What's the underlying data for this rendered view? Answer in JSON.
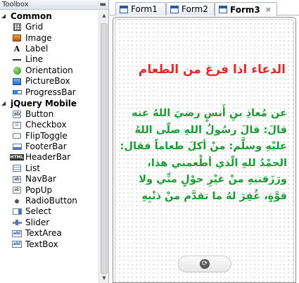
{
  "toolbox": {
    "title": "Toolbox",
    "groups": [
      {
        "label": "Common",
        "items": [
          {
            "label": "Grid",
            "icon": "grid-icon"
          },
          {
            "label": "Image",
            "icon": "image-icon"
          },
          {
            "label": "Label",
            "icon": "label-icon"
          },
          {
            "label": "Line",
            "icon": "line-icon"
          },
          {
            "label": "Orientation",
            "icon": "orientation-icon"
          },
          {
            "label": "PictureBox",
            "icon": "picturebox-icon"
          },
          {
            "label": "ProgressBar",
            "icon": "progressbar-icon"
          }
        ]
      },
      {
        "label": "jQuery Mobile",
        "items": [
          {
            "label": "Button",
            "icon": "button-icon",
            "icon_text": "ab"
          },
          {
            "label": "Checkbox",
            "icon": "checkbox-icon"
          },
          {
            "label": "FlipToggle",
            "icon": "fliptoggle-icon"
          },
          {
            "label": "FooterBar",
            "icon": "footerbar-icon"
          },
          {
            "label": "HeaderBar",
            "icon": "headerbar-icon",
            "icon_text": "HTML"
          },
          {
            "label": "List",
            "icon": "list-icon"
          },
          {
            "label": "NavBar",
            "icon": "navbar-icon",
            "icon_text": "ab"
          },
          {
            "label": "PopUp",
            "icon": "popup-icon",
            "icon_text": "ab"
          },
          {
            "label": "RadioButton",
            "icon": "radiobutton-icon"
          },
          {
            "label": "Select",
            "icon": "select-icon"
          },
          {
            "label": "Slider",
            "icon": "slider-icon"
          },
          {
            "label": "TextArea",
            "icon": "textarea-icon",
            "icon_text": "abl"
          },
          {
            "label": "TextBox",
            "icon": "textbox-icon",
            "icon_text": "abl"
          }
        ]
      }
    ]
  },
  "tabs": [
    {
      "label": "Form1",
      "active": false
    },
    {
      "label": "Form2",
      "active": false
    },
    {
      "label": "Form3",
      "active": true,
      "close": "×"
    }
  ],
  "form": {
    "title": "الدعاء اذا فرغ من الطعام",
    "body": "عن مُعاذِ بنِ أَنسٍ رضيَ اللهُ عنه قالَ: قالَ رسُولُ اللهِ صلّى اللهُ عليْهِ وسلَّم: منْ أكلَ طعاماً فقال: الحمْدُ للهِ الّذي أطْعمني هذا، ورَزَقنيهِ منْ غيْرِ حوْلٍ منِّي ولا قوَّةٍ، غُفِرَ لهُ ما تقدَّم منْ ذنْبِهِ",
    "title_color": "#e32a2a",
    "body_color": "#1f9a35",
    "footer_button_icon": "refresh-icon"
  }
}
